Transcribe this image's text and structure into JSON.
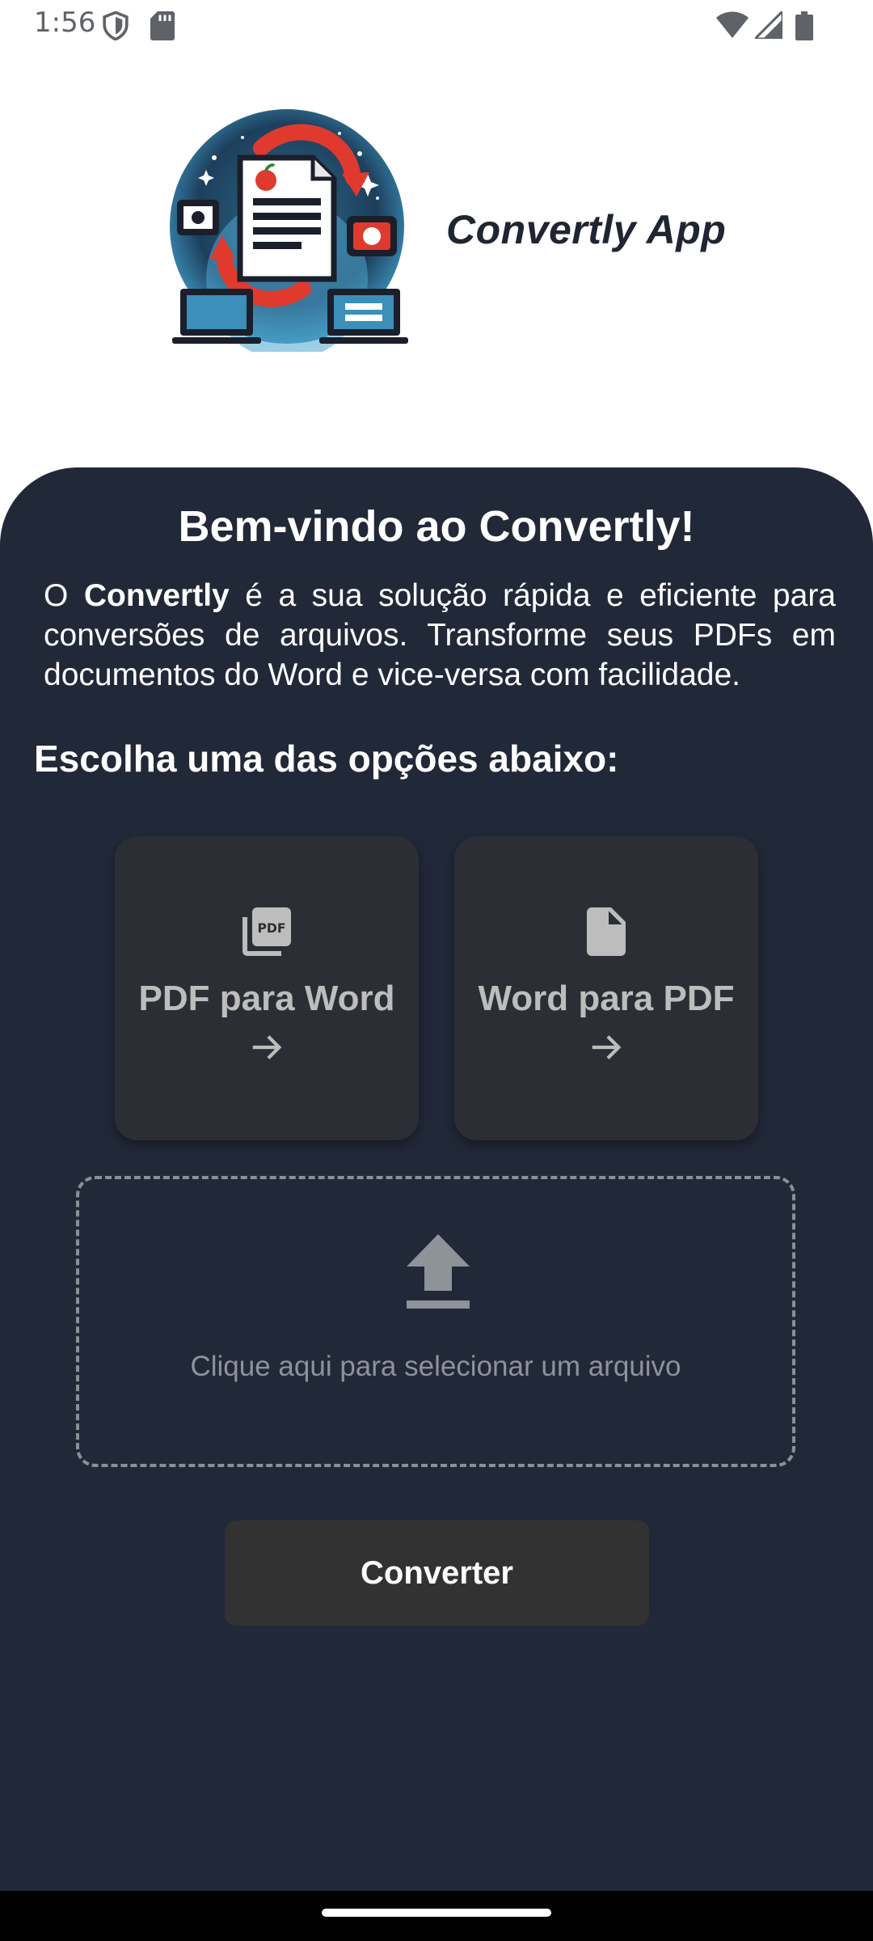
{
  "status_bar": {
    "time": "1:56",
    "icons": [
      "shield-icon",
      "sd-card-icon",
      "wifi-icon",
      "signal-icon",
      "battery-icon"
    ]
  },
  "header": {
    "app_name": "Convertly App",
    "logo_icon": "document-conversion-logo"
  },
  "main": {
    "title": "Bem-vindo ao Convertly!",
    "intro_prefix": "O ",
    "intro_bold": "Convertly",
    "intro_rest": " é a sua solução rápida e eficiente para conversões de arquivos. Transforme seus PDFs em documentos do Word e vice-versa com facilidade.",
    "choose_label": "Escolha uma das opções abaixo:",
    "options": [
      {
        "label": "PDF para Word",
        "icon": "pdf-icon",
        "arrow": "arrow-right-icon"
      },
      {
        "label": "Word para PDF",
        "icon": "document-icon",
        "arrow": "arrow-right-icon"
      }
    ],
    "upload": {
      "text": "Clique aqui para selecionar um arquivo",
      "icon": "upload-icon"
    },
    "convert_label": "Converter"
  },
  "colors": {
    "panel_bg": "#212838",
    "card_bg": "#2b2e35",
    "button_bg": "#323232",
    "card_text": "#bdbdbd"
  }
}
